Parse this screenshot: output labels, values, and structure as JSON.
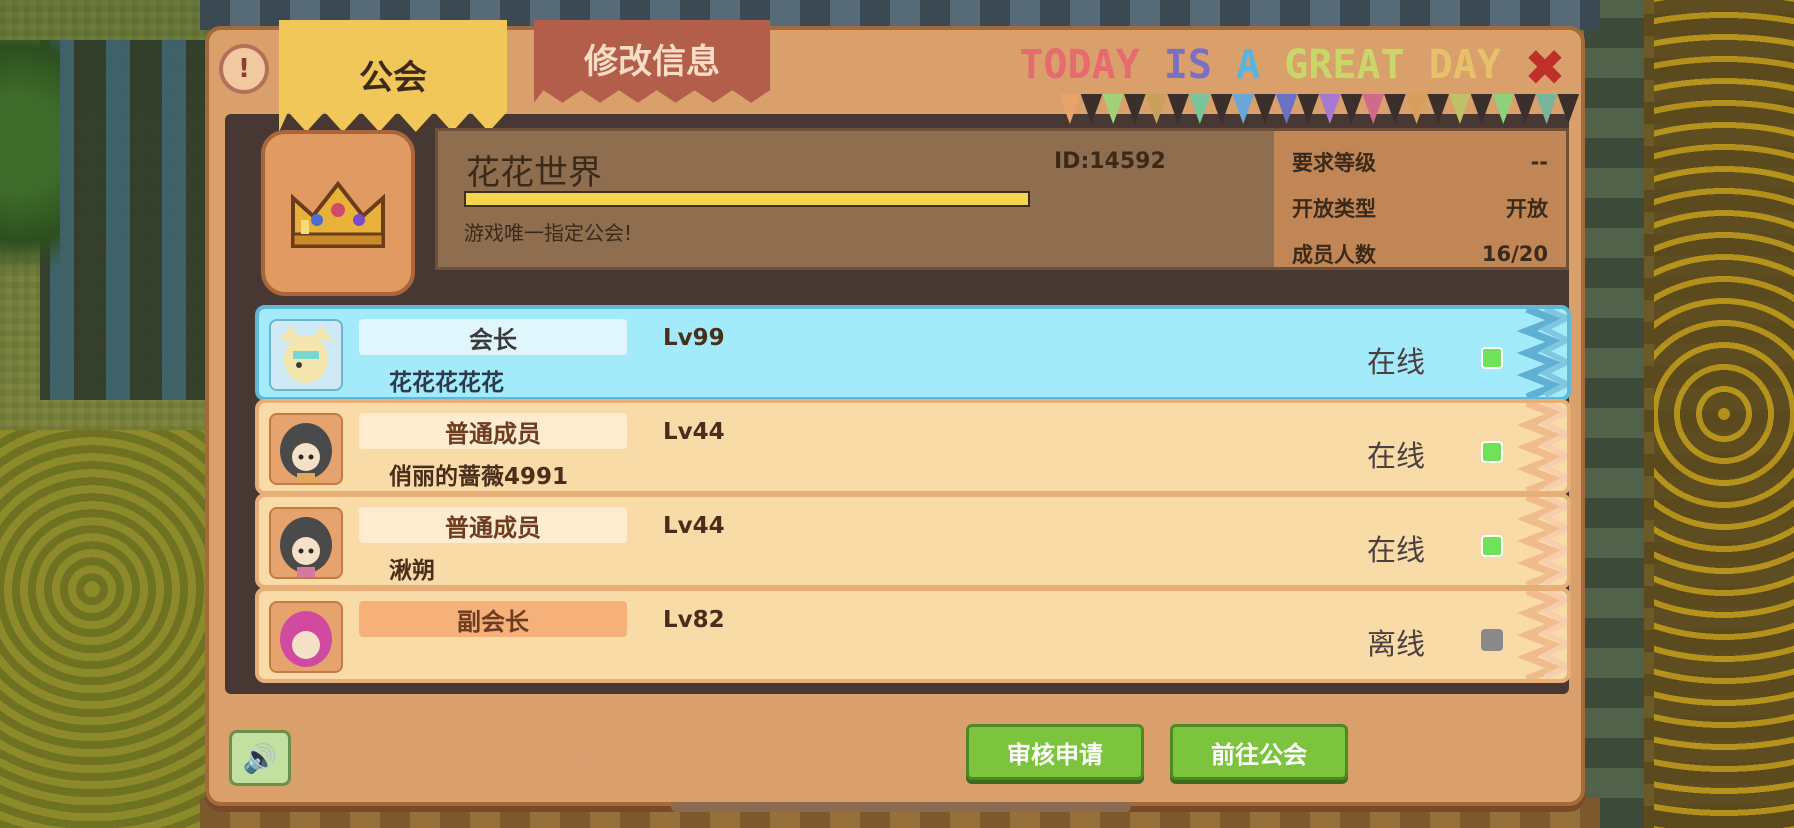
{
  "tabs": {
    "guild": "公会",
    "edit": "修改信息"
  },
  "banner": {
    "words": [
      {
        "text": "TODAY ",
        "color": "#e66a6e"
      },
      {
        "text": "IS ",
        "color": "#7a6fc4"
      },
      {
        "text": "A ",
        "color": "#5ab4e0"
      },
      {
        "text": "GREAT ",
        "color": "#c9d66a"
      },
      {
        "text": "DAY",
        "color": "#e6c06a"
      }
    ]
  },
  "pennant_colors": [
    "#e9a36a",
    "#a3d07a",
    "#c8a05a",
    "#7ac49a",
    "#6aa6d8",
    "#6a72c8",
    "#a57ad0",
    "#cf6a8a",
    "#d6a05a",
    "#c0c06a",
    "#8fd07a",
    "#7ab49a"
  ],
  "close_symbol": "✖",
  "help_symbol": "!",
  "guild": {
    "name": "花花世界",
    "id_label": "ID:14592",
    "progress": 1.0,
    "description": "游戏唯一指定公会!",
    "stats": [
      {
        "label": "要求等级",
        "value": "--"
      },
      {
        "label": "开放类型",
        "value": "开放"
      },
      {
        "label": "成员人数",
        "value": "16/20"
      }
    ]
  },
  "members": [
    {
      "role": "会长",
      "name": "花花花花花",
      "level": "Lv99",
      "status": "在线",
      "online": true,
      "type": "leader"
    },
    {
      "role": "普通成员",
      "name": "俏丽的蔷薇4991",
      "level": "Lv44",
      "status": "在线",
      "online": true,
      "type": "normal"
    },
    {
      "role": "普通成员",
      "name": "湫朔",
      "level": "Lv44",
      "status": "在线",
      "online": true,
      "type": "normal"
    },
    {
      "role": "副会长",
      "name": "",
      "level": "Lv82",
      "status": "离线",
      "online": false,
      "type": "vice"
    }
  ],
  "footer": {
    "sound_icon": "speaker-icon",
    "review_button": "审核申请",
    "goto_button": "前往公会"
  },
  "colors": {
    "online": "#6fe25a",
    "offline": "#8a8a8a",
    "button_green": "#7cc43e"
  }
}
